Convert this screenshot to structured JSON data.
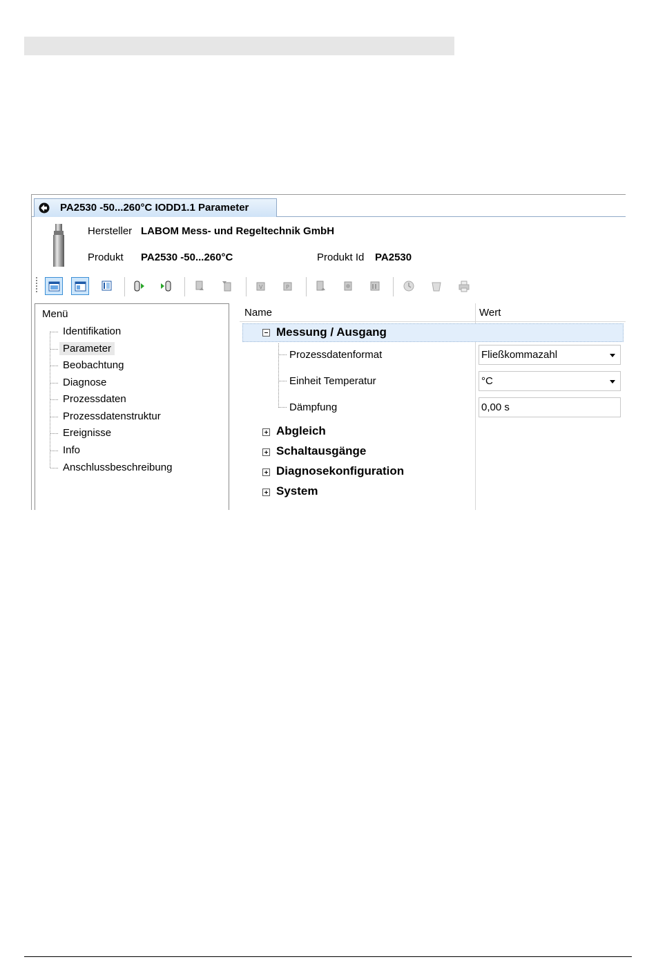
{
  "window": {
    "tab_title": "PA2530 -50...260°C IODD1.1 Parameter",
    "tab_icon": "device-icon"
  },
  "device_info": {
    "manufacturer_label": "Hersteller",
    "manufacturer_value": "LABOM Mess- und Regeltechnik GmbH",
    "product_label": "Produkt",
    "product_value": "PA2530 -50...260°C",
    "product_id_label": "Produkt Id",
    "product_id_value": "PA2530"
  },
  "toolbar": {
    "buttons": [
      "layout-online-icon",
      "layout-offline-icon",
      "layout-list-icon",
      "read-from-device-icon",
      "write-to-device-icon",
      "upload-parameter-icon",
      "download-parameter-icon",
      "upload-variable-icon",
      "download-variable-icon",
      "compare-icon",
      "reset-icon",
      "report-icon",
      "clock-icon",
      "delete-icon",
      "print-icon"
    ]
  },
  "menu": {
    "title": "Menü",
    "items": [
      "Identifikation",
      "Parameter",
      "Beobachtung",
      "Diagnose",
      "Prozessdaten",
      "Prozessdatenstruktur",
      "Ereignisse",
      "Info",
      "Anschlussbeschreibung"
    ],
    "selected": "Parameter"
  },
  "params": {
    "col_name": "Name",
    "col_value": "Wert",
    "groups": {
      "messung": "Messung / Ausgang",
      "abgleich": "Abgleich",
      "schalt": "Schaltausgänge",
      "diag": "Diagnosekonfiguration",
      "system": "System"
    },
    "rows": [
      {
        "label": "Prozessdatenformat",
        "value": "Fließkommazahl",
        "type": "dropdown"
      },
      {
        "label": "Einheit Temperatur",
        "value": "°C",
        "type": "dropdown"
      },
      {
        "label": "Dämpfung",
        "value": "0,00 s",
        "type": "text"
      }
    ]
  },
  "colors": {
    "tab_bg": "#cfe3f7",
    "selection_bg": "#e2eefb",
    "active_tool": "#cde6fb"
  }
}
